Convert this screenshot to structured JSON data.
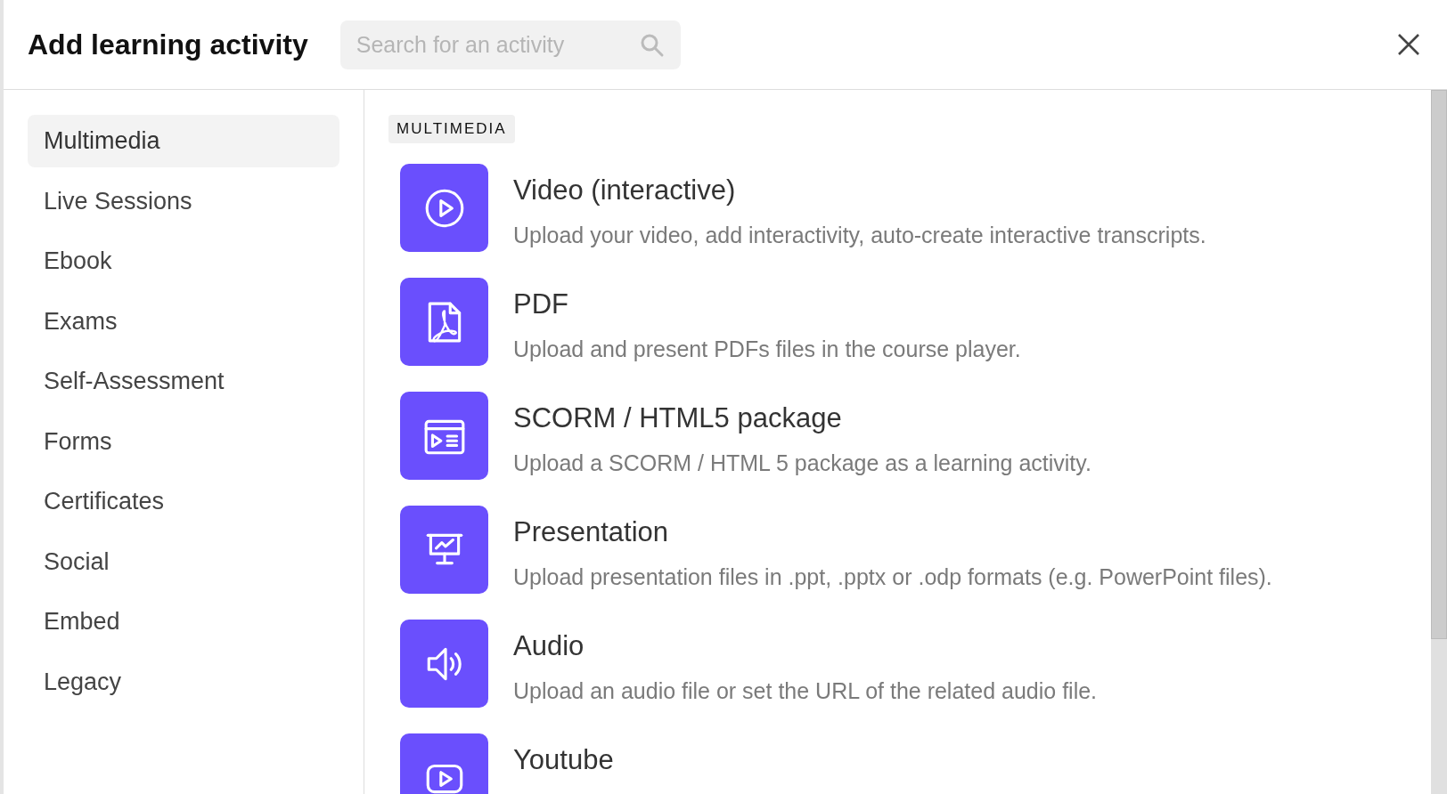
{
  "header": {
    "title": "Add learning activity",
    "search": {
      "placeholder": "Search for an activity"
    }
  },
  "sidebar": {
    "items": [
      {
        "label": "Multimedia",
        "selected": true
      },
      {
        "label": "Live Sessions",
        "selected": false
      },
      {
        "label": "Ebook",
        "selected": false
      },
      {
        "label": "Exams",
        "selected": false
      },
      {
        "label": "Self-Assessment",
        "selected": false
      },
      {
        "label": "Forms",
        "selected": false
      },
      {
        "label": "Certificates",
        "selected": false
      },
      {
        "label": "Social",
        "selected": false
      },
      {
        "label": "Embed",
        "selected": false
      },
      {
        "label": "Legacy",
        "selected": false
      }
    ]
  },
  "section": {
    "heading": "MULTIMEDIA",
    "activities": [
      {
        "kind": "video",
        "title": "Video (interactive)",
        "description": "Upload your video, add interactivity, auto-create interactive transcripts."
      },
      {
        "kind": "pdf",
        "title": "PDF",
        "description": "Upload and present PDFs files in the course player."
      },
      {
        "kind": "package",
        "title": "SCORM / HTML5 package",
        "description": "Upload a SCORM / HTML 5 package as a learning activity."
      },
      {
        "kind": "presentation",
        "title": "Presentation",
        "description": "Upload presentation files in .ppt, .pptx or .odp formats (e.g. PowerPoint files)."
      },
      {
        "kind": "audio",
        "title": "Audio",
        "description": "Upload an audio file or set the URL of the related audio file."
      },
      {
        "kind": "youtube",
        "title": "Youtube"
      }
    ]
  }
}
